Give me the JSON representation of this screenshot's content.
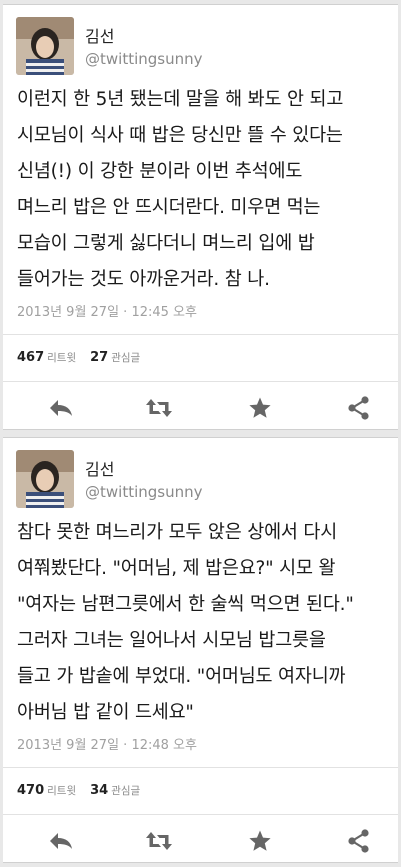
{
  "tweets": [
    {
      "name": "김선",
      "handle": "@twittingsunny",
      "text": "이런지 한 5년 됐는데 말을 해 봐도 안 되고\n시모님이 식사 때 밥은 당신만 뜰 수 있다는\n신념(!) 이 강한 분이라 이번 추석에도\n며느리 밥은 안 뜨시더란다. 미우면 먹는\n모습이 그렇게 싫다더니 며느리 입에 밥\n들어가는 것도 아까운거라. 참 나.",
      "timestamp": "2013년 9월 27일 · 12:45 오후",
      "retweets": "467",
      "retweets_label": "리트윗",
      "favorites": "27",
      "favorites_label": "관심글"
    },
    {
      "name": "김선",
      "handle": "@twittingsunny",
      "text": "참다 못한 며느리가 모두 앉은 상에서 다시\n여쭤봤단다. \"어머님, 제 밥은요?\" 시모 왈\n\"여자는 남편그릇에서 한 술씩 먹으면 된다.\"\n그러자 그녀는 일어나서 시모님 밥그릇을\n들고 가 밥솥에 부었대. \"어머님도 여자니까\n아버님 밥 같이 드세요\"",
      "timestamp": "2013년 9월 27일 · 12:48 오후",
      "retweets": "470",
      "retweets_label": "리트윗",
      "favorites": "34",
      "favorites_label": "관심글"
    }
  ],
  "icons": {
    "reply": "reply-icon",
    "retweet": "retweet-icon",
    "favorite": "star-icon",
    "share": "share-icon"
  },
  "colors": {
    "icon": "#666666",
    "muted": "#8a8a8a"
  }
}
